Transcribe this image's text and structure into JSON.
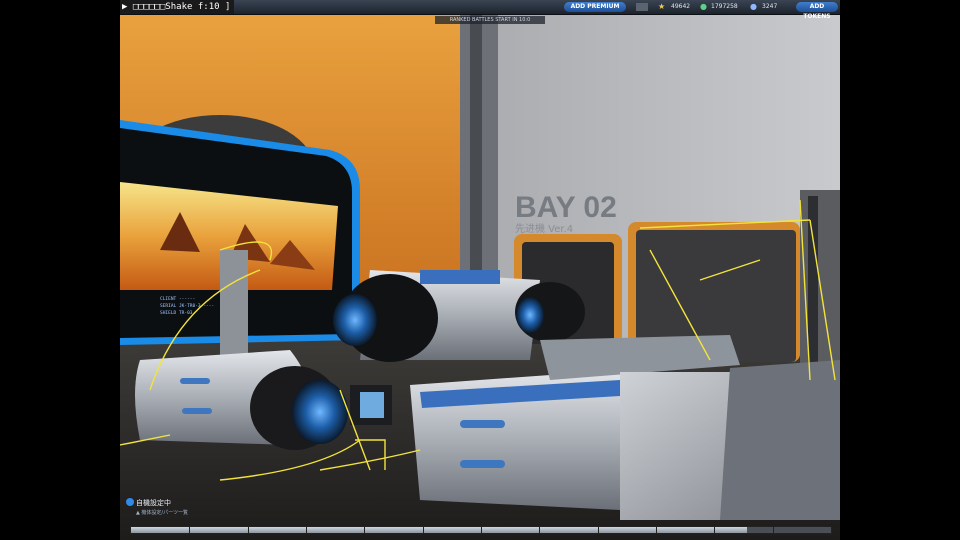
{
  "hud": {
    "debug_text": "▶ □□□□□□Shake f:10 ]",
    "ticker": "RANKED BATTLES START IN 10:0",
    "premium_button": "ADD PREMIUM",
    "icon_a": "star-icon",
    "stat_a": "49642",
    "stat_b": "1797258",
    "stat_c": "3247",
    "tokens_button": "ADD TOKENS"
  },
  "scene": {
    "bay_label": "BAY 02",
    "bay_sublabel": "先进機 Ver.4",
    "screen_text_lines": [
      "CLIENT  ------",
      "SERIAL  JK-TR0-3 ----",
      "SHIELD  TR-03"
    ]
  },
  "bottom": {
    "label": "自機設定中",
    "sub": "▲  機体設定/パーツ一覧",
    "timeline_progress": 0.88
  }
}
